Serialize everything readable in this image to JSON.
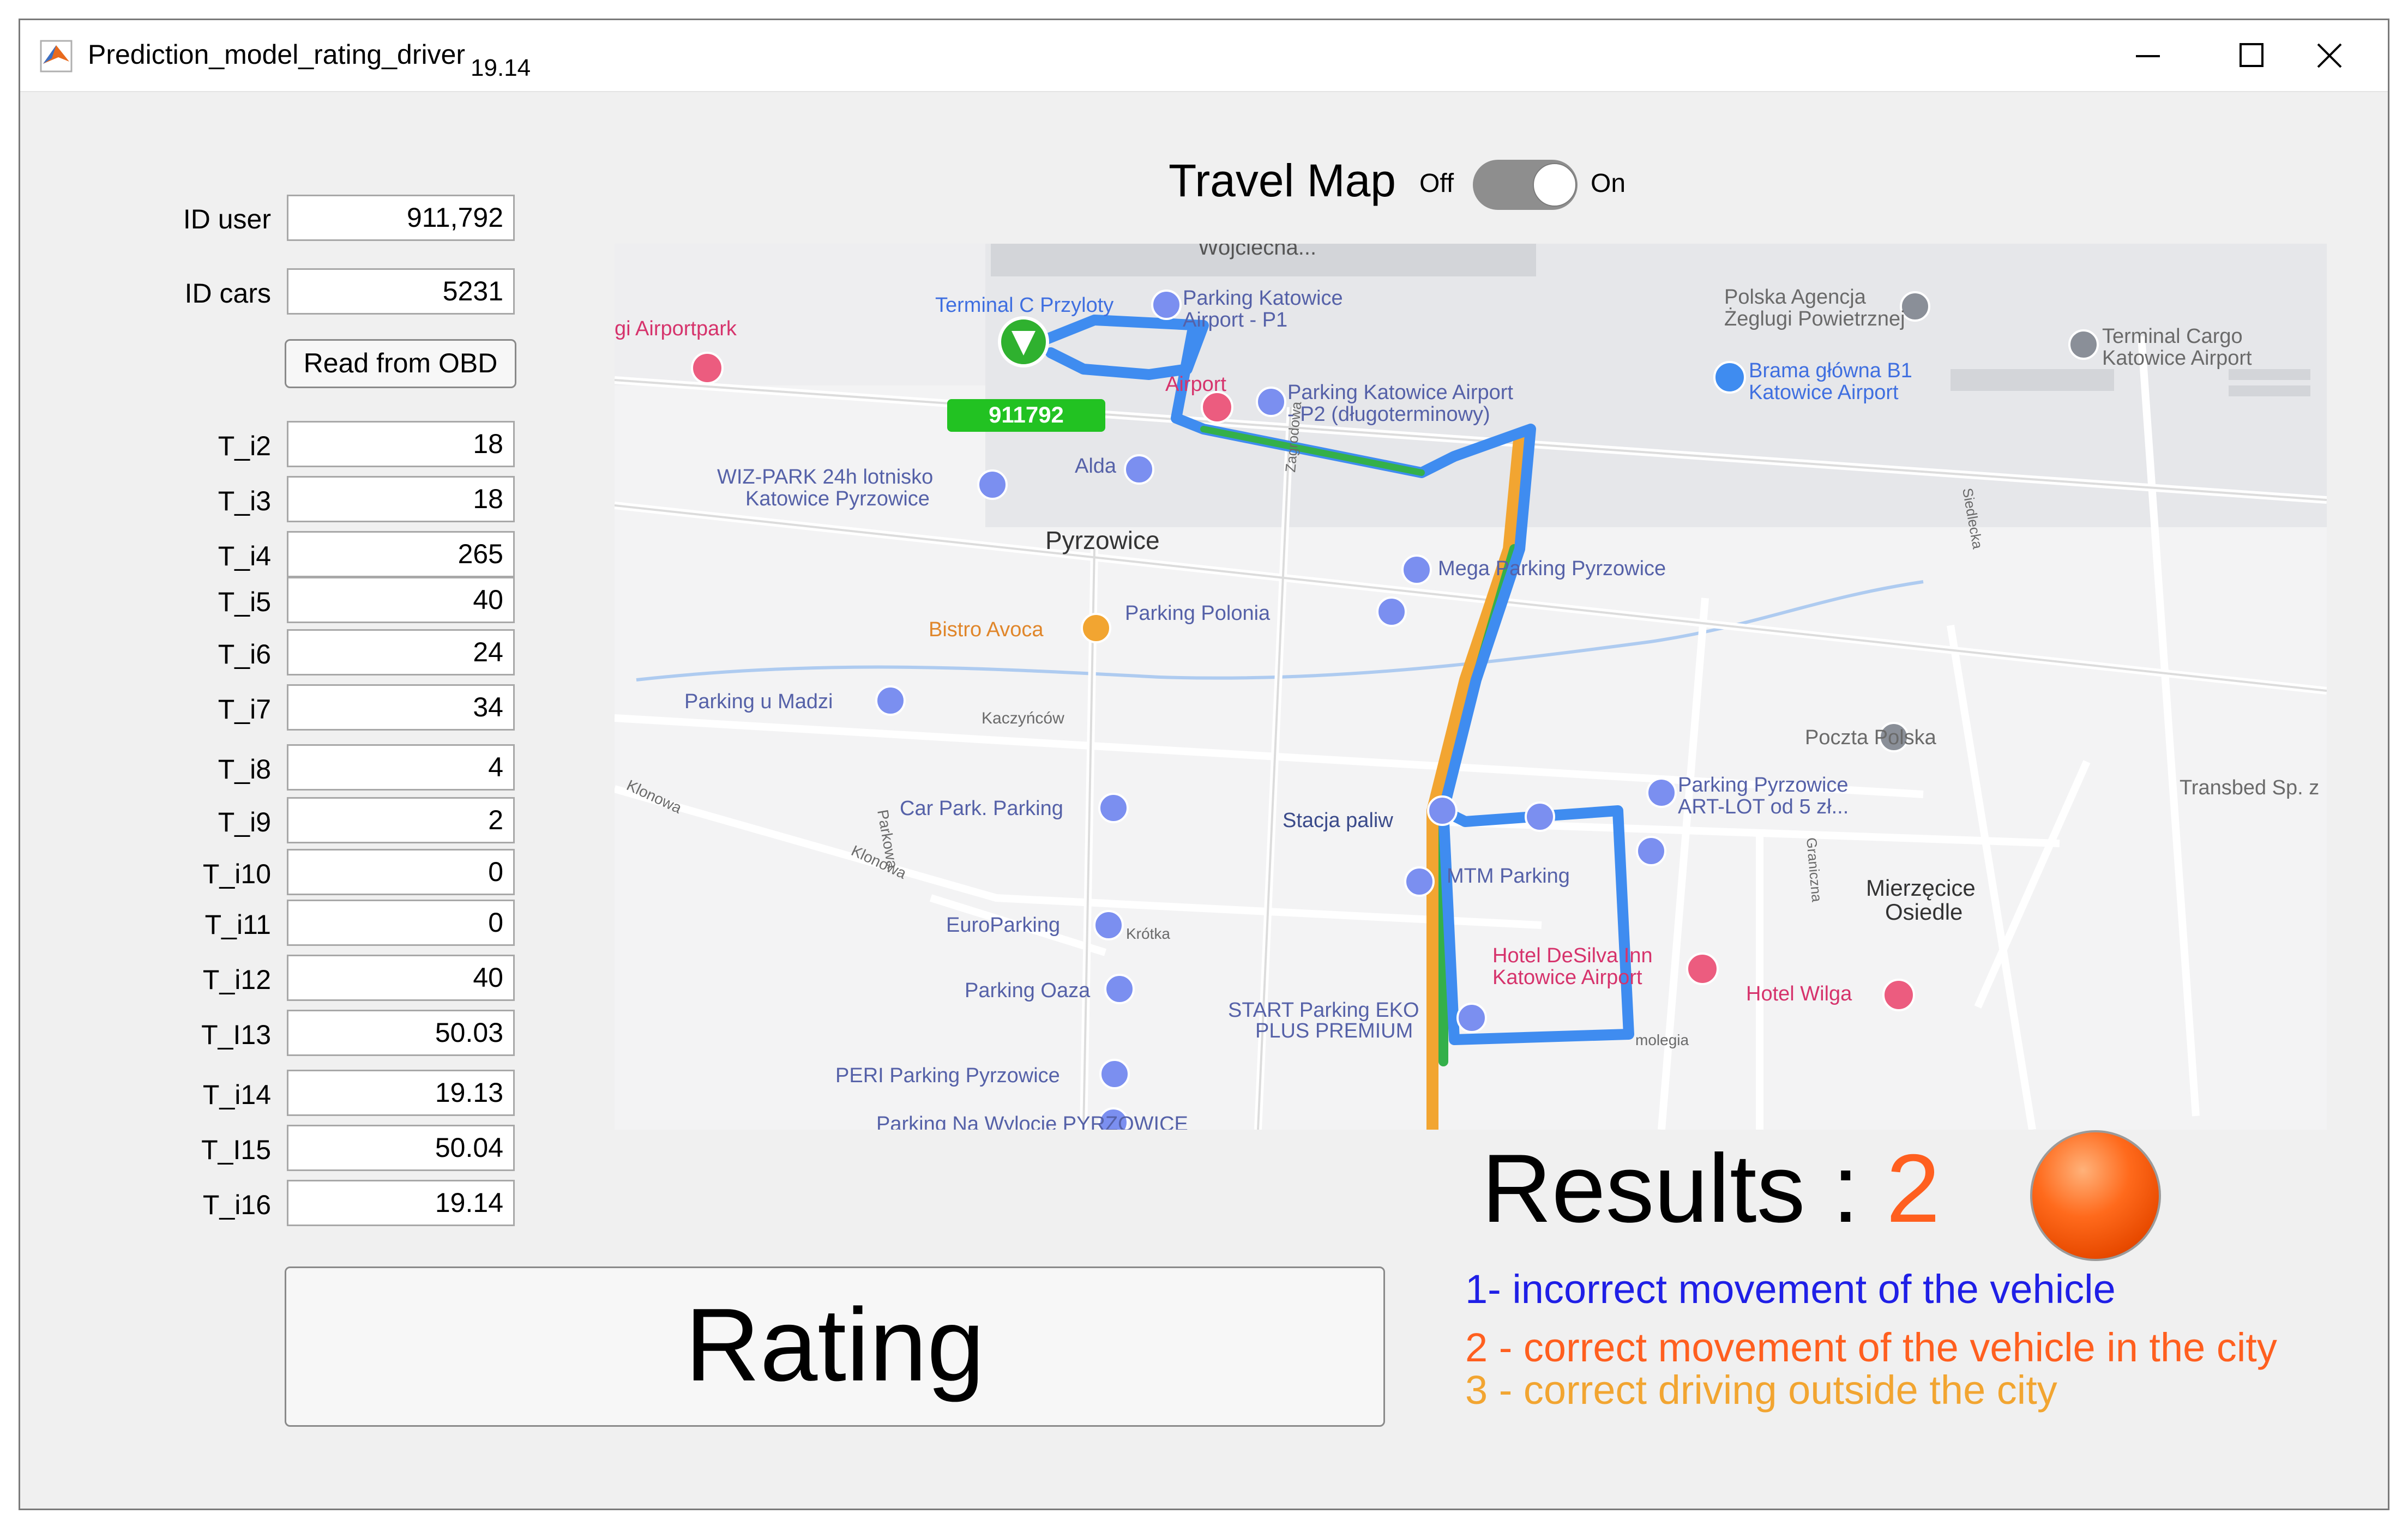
{
  "window": {
    "title": "Prediction_model_rating_driver",
    "version": "19.14"
  },
  "form": {
    "id_user": {
      "label": "ID user",
      "value": "911,792"
    },
    "id_cars": {
      "label": "ID cars",
      "value": "5231"
    },
    "read_obd_label": "Read from OBD",
    "fields": [
      {
        "label": "T_i2",
        "value": "18"
      },
      {
        "label": "T_i3",
        "value": "18"
      },
      {
        "label": "T_i4",
        "value": "265"
      },
      {
        "label": "T_i5",
        "value": "40"
      },
      {
        "label": "T_i6",
        "value": "24"
      },
      {
        "label": "T_i7",
        "value": "34"
      },
      {
        "label": "T_i8",
        "value": "4"
      },
      {
        "label": "T_i9",
        "value": "2"
      },
      {
        "label": "T_i10",
        "value": "0"
      },
      {
        "label": "T_i11",
        "value": "0"
      },
      {
        "label": "T_i12",
        "value": "40"
      },
      {
        "label": "T_I13",
        "value": "50.03"
      },
      {
        "label": "T_i14",
        "value": "19.13"
      },
      {
        "label": "T_I15",
        "value": "50.04"
      },
      {
        "label": "T_i16",
        "value": "19.14"
      }
    ],
    "rating_label": "Rating"
  },
  "map": {
    "title": "Travel Map",
    "toggle_off": "Off",
    "toggle_on": "On",
    "toggle_state": "on",
    "marker_label": "911792",
    "places": {
      "wojciecha": "Wojciecha...",
      "terminal_c": "Terminal C Przyloty",
      "parking_p1": "Parking Katowice\nAirport - P1",
      "polska_agencja": "Polska Agencja\nŻeglugi Powietrznej",
      "terminal_cargo": "Terminal Cargo\nKatowice Airport",
      "airportpark": "gi Airportpark",
      "brama": "Brama główna B1\nKatowice Airport",
      "parking_p2": "Parking Katowice Airport\n- P2 (długoterminowy)",
      "airport_hotel": "Airport",
      "alda": "Alda",
      "wiz_park": "WIZ-PARK 24h lotnisko\nKatowice Pyrzowice",
      "pyrzowice": "Pyrzowice",
      "zagrodowa": "Zagrodowa",
      "mega_parking": "Mega Parking Pyrzowice",
      "bistro": "Bistro Avoca",
      "parking_polonia": "Parking Polonia",
      "parking_u_madzi": "Parking u Madzi",
      "kaczyncow": "Kaczyńców",
      "poczta": "Poczta Polska",
      "parking_art_lot": "Parking Pyrzowice\nART-LOT od 5 zł...",
      "transbed": "Transbed Sp. z",
      "klonowa": "Klonowa",
      "car_park": "Car Park. Parking",
      "stacja": "Stacja paliw",
      "parkowa": "Parkowa",
      "klonowa2": "Klonowa",
      "mtm": "MTM Parking",
      "mierzecice": "Mierzęcice\nOsiedle",
      "graniczna": "Graniczna",
      "europarking": "EuroParking",
      "krotka": "Krótka",
      "hotel_desilva": "Hotel DeSilva Inn\nKatowice Airport",
      "parking_oaza": "Parking Oaza",
      "start_parking": "START Parking EKO\nPLUS PREMIUM",
      "molegia": "molegia",
      "hotel_wilga": "Hotel Wilga",
      "peri": "PERI Parking Pyrzowice",
      "na_wylocie": "Parking Na Wylocie\nPYRZOWICE",
      "siedlecka": "Siedlecka"
    }
  },
  "results": {
    "label": "Results : ",
    "value": "2",
    "lamp_color": "#ff6a1c"
  },
  "legend": [
    {
      "text": "1- incorrect movement of the vehicle",
      "color": "#1f1fe6"
    },
    {
      "text": "2 - correct movement of the vehicle in the city",
      "color": "#ff5f1f"
    },
    {
      "text": "3 - correct driving outside the city",
      "color": "#f2a531"
    }
  ]
}
